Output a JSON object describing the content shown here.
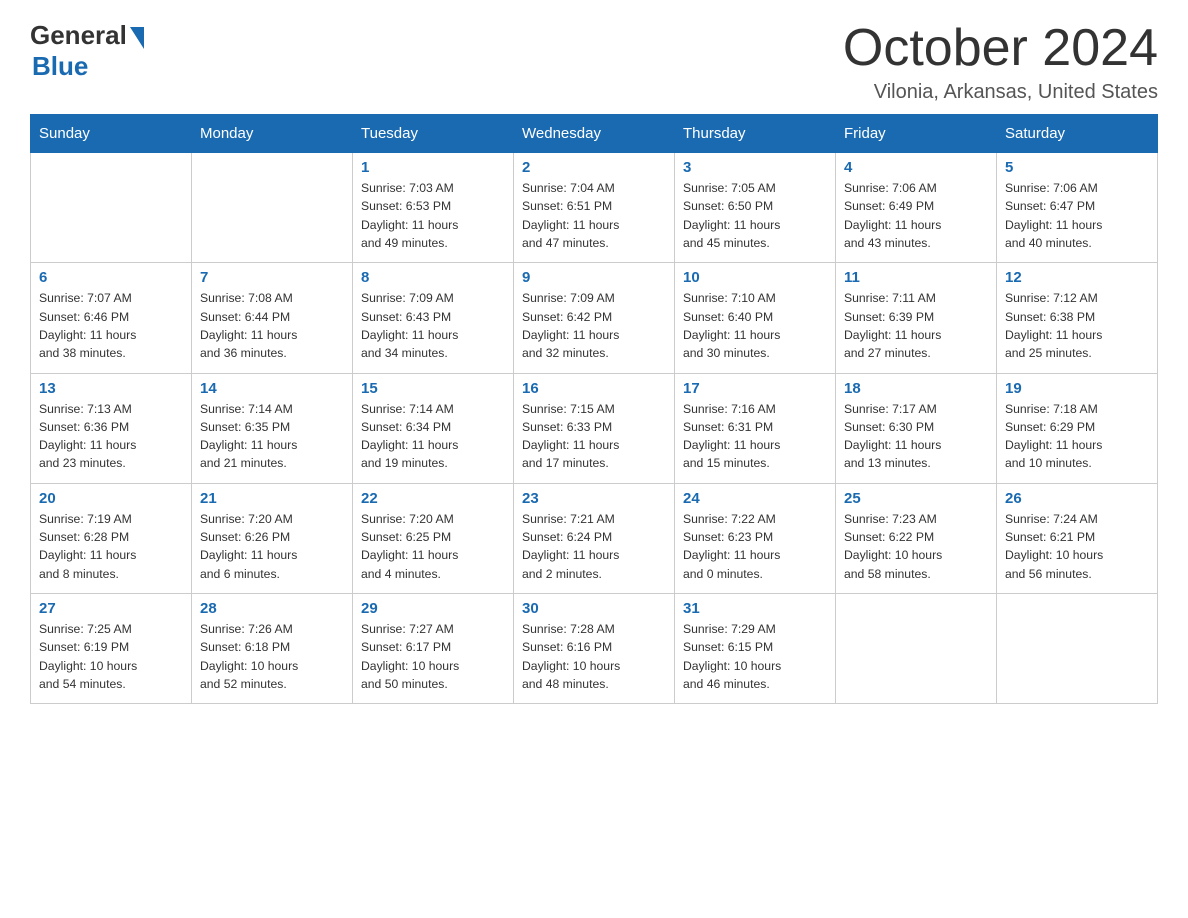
{
  "header": {
    "logo_general": "General",
    "logo_blue": "Blue",
    "month_title": "October 2024",
    "location": "Vilonia, Arkansas, United States"
  },
  "days_of_week": [
    "Sunday",
    "Monday",
    "Tuesday",
    "Wednesday",
    "Thursday",
    "Friday",
    "Saturday"
  ],
  "weeks": [
    [
      {
        "day": "",
        "info": ""
      },
      {
        "day": "",
        "info": ""
      },
      {
        "day": "1",
        "info": "Sunrise: 7:03 AM\nSunset: 6:53 PM\nDaylight: 11 hours\nand 49 minutes."
      },
      {
        "day": "2",
        "info": "Sunrise: 7:04 AM\nSunset: 6:51 PM\nDaylight: 11 hours\nand 47 minutes."
      },
      {
        "day": "3",
        "info": "Sunrise: 7:05 AM\nSunset: 6:50 PM\nDaylight: 11 hours\nand 45 minutes."
      },
      {
        "day": "4",
        "info": "Sunrise: 7:06 AM\nSunset: 6:49 PM\nDaylight: 11 hours\nand 43 minutes."
      },
      {
        "day": "5",
        "info": "Sunrise: 7:06 AM\nSunset: 6:47 PM\nDaylight: 11 hours\nand 40 minutes."
      }
    ],
    [
      {
        "day": "6",
        "info": "Sunrise: 7:07 AM\nSunset: 6:46 PM\nDaylight: 11 hours\nand 38 minutes."
      },
      {
        "day": "7",
        "info": "Sunrise: 7:08 AM\nSunset: 6:44 PM\nDaylight: 11 hours\nand 36 minutes."
      },
      {
        "day": "8",
        "info": "Sunrise: 7:09 AM\nSunset: 6:43 PM\nDaylight: 11 hours\nand 34 minutes."
      },
      {
        "day": "9",
        "info": "Sunrise: 7:09 AM\nSunset: 6:42 PM\nDaylight: 11 hours\nand 32 minutes."
      },
      {
        "day": "10",
        "info": "Sunrise: 7:10 AM\nSunset: 6:40 PM\nDaylight: 11 hours\nand 30 minutes."
      },
      {
        "day": "11",
        "info": "Sunrise: 7:11 AM\nSunset: 6:39 PM\nDaylight: 11 hours\nand 27 minutes."
      },
      {
        "day": "12",
        "info": "Sunrise: 7:12 AM\nSunset: 6:38 PM\nDaylight: 11 hours\nand 25 minutes."
      }
    ],
    [
      {
        "day": "13",
        "info": "Sunrise: 7:13 AM\nSunset: 6:36 PM\nDaylight: 11 hours\nand 23 minutes."
      },
      {
        "day": "14",
        "info": "Sunrise: 7:14 AM\nSunset: 6:35 PM\nDaylight: 11 hours\nand 21 minutes."
      },
      {
        "day": "15",
        "info": "Sunrise: 7:14 AM\nSunset: 6:34 PM\nDaylight: 11 hours\nand 19 minutes."
      },
      {
        "day": "16",
        "info": "Sunrise: 7:15 AM\nSunset: 6:33 PM\nDaylight: 11 hours\nand 17 minutes."
      },
      {
        "day": "17",
        "info": "Sunrise: 7:16 AM\nSunset: 6:31 PM\nDaylight: 11 hours\nand 15 minutes."
      },
      {
        "day": "18",
        "info": "Sunrise: 7:17 AM\nSunset: 6:30 PM\nDaylight: 11 hours\nand 13 minutes."
      },
      {
        "day": "19",
        "info": "Sunrise: 7:18 AM\nSunset: 6:29 PM\nDaylight: 11 hours\nand 10 minutes."
      }
    ],
    [
      {
        "day": "20",
        "info": "Sunrise: 7:19 AM\nSunset: 6:28 PM\nDaylight: 11 hours\nand 8 minutes."
      },
      {
        "day": "21",
        "info": "Sunrise: 7:20 AM\nSunset: 6:26 PM\nDaylight: 11 hours\nand 6 minutes."
      },
      {
        "day": "22",
        "info": "Sunrise: 7:20 AM\nSunset: 6:25 PM\nDaylight: 11 hours\nand 4 minutes."
      },
      {
        "day": "23",
        "info": "Sunrise: 7:21 AM\nSunset: 6:24 PM\nDaylight: 11 hours\nand 2 minutes."
      },
      {
        "day": "24",
        "info": "Sunrise: 7:22 AM\nSunset: 6:23 PM\nDaylight: 11 hours\nand 0 minutes."
      },
      {
        "day": "25",
        "info": "Sunrise: 7:23 AM\nSunset: 6:22 PM\nDaylight: 10 hours\nand 58 minutes."
      },
      {
        "day": "26",
        "info": "Sunrise: 7:24 AM\nSunset: 6:21 PM\nDaylight: 10 hours\nand 56 minutes."
      }
    ],
    [
      {
        "day": "27",
        "info": "Sunrise: 7:25 AM\nSunset: 6:19 PM\nDaylight: 10 hours\nand 54 minutes."
      },
      {
        "day": "28",
        "info": "Sunrise: 7:26 AM\nSunset: 6:18 PM\nDaylight: 10 hours\nand 52 minutes."
      },
      {
        "day": "29",
        "info": "Sunrise: 7:27 AM\nSunset: 6:17 PM\nDaylight: 10 hours\nand 50 minutes."
      },
      {
        "day": "30",
        "info": "Sunrise: 7:28 AM\nSunset: 6:16 PM\nDaylight: 10 hours\nand 48 minutes."
      },
      {
        "day": "31",
        "info": "Sunrise: 7:29 AM\nSunset: 6:15 PM\nDaylight: 10 hours\nand 46 minutes."
      },
      {
        "day": "",
        "info": ""
      },
      {
        "day": "",
        "info": ""
      }
    ]
  ]
}
